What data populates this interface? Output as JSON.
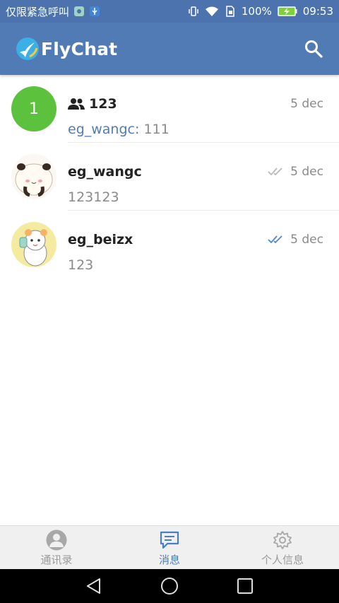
{
  "status_bar": {
    "carrier": "仅限紧急呼叫",
    "battery": "100%",
    "time": "09:53"
  },
  "app_bar": {
    "title": "FlyChat"
  },
  "chats": [
    {
      "avatar_text": "1",
      "avatar_color": "#5cc23e",
      "is_group": true,
      "name": "123",
      "sender": "eg_wangc: ",
      "message": "111",
      "date": "5 dec",
      "checkmark": "none"
    },
    {
      "avatar_kind": "panda-girl",
      "is_group": false,
      "name": "eg_wangc",
      "sender": "",
      "message": "123123",
      "date": "5 dec",
      "checkmark": "read-gray"
    },
    {
      "avatar_kind": "hamster",
      "is_group": false,
      "name": "eg_beizx",
      "sender": "",
      "message": "123",
      "date": "5 dec",
      "checkmark": "read-blue"
    }
  ],
  "bottom_nav": {
    "contacts": "通讯录",
    "messages": "消息",
    "profile": "个人信息",
    "active": "messages"
  },
  "colors": {
    "primary": "#507bb5",
    "accent": "#4a7fc1",
    "green": "#5cc23e"
  }
}
